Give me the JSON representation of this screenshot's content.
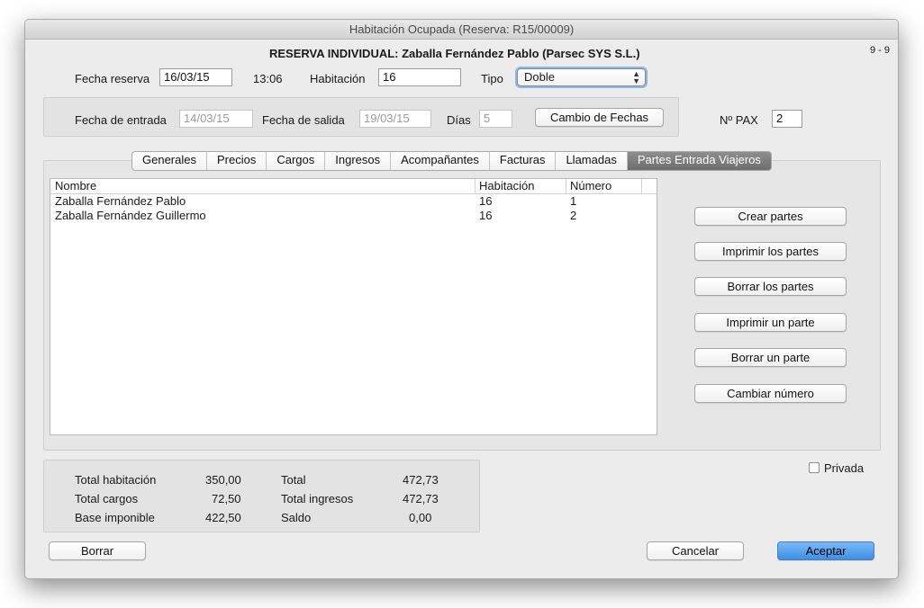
{
  "window": {
    "title": "Habitación Ocupada (Reserva: R15/00009)"
  },
  "header": {
    "title": "RESERVA INDIVIDUAL: Zaballa Fernández Pablo (Parsec SYS S.L.)",
    "record_counter": "9 - 9"
  },
  "reserva": {
    "fecha_label": "Fecha reserva",
    "fecha_value": "16/03/15",
    "hora": "13:06",
    "habitacion_label": "Habitación",
    "habitacion_value": "16",
    "tipo_label": "Tipo",
    "tipo_value": "Doble"
  },
  "fechas": {
    "entrada_label": "Fecha de entrada",
    "entrada_value": "14/03/15",
    "salida_label": "Fecha de salida",
    "salida_value": "19/03/15",
    "dias_label": "Días",
    "dias_value": "5",
    "cambio_button": "Cambio de Fechas"
  },
  "pax": {
    "label": "Nº PAX",
    "value": "2"
  },
  "tabs": [
    {
      "label": "Generales"
    },
    {
      "label": "Precios"
    },
    {
      "label": "Cargos"
    },
    {
      "label": "Ingresos"
    },
    {
      "label": "Acompañantes"
    },
    {
      "label": "Facturas"
    },
    {
      "label": "Llamadas"
    },
    {
      "label": "Partes Entrada Viajeros"
    }
  ],
  "table": {
    "columns": [
      "Nombre",
      "Habitación",
      "Número"
    ],
    "rows": [
      {
        "nombre": "Zaballa Fernández Pablo",
        "habitacion": "16",
        "numero": "1"
      },
      {
        "nombre": "Zaballa Fernández Guillermo",
        "habitacion": "16",
        "numero": "2"
      }
    ]
  },
  "actions": {
    "crear": "Crear partes",
    "imprimir_los": "Imprimir los partes",
    "borrar_los": "Borrar los partes",
    "imprimir_un": "Imprimir un parte",
    "borrar_un": "Borrar un parte",
    "cambiar_numero": "Cambiar número"
  },
  "totals": {
    "total_habitacion_label": "Total habitación",
    "total_habitacion_value": "350,00",
    "total_cargos_label": "Total cargos",
    "total_cargos_value": "72,50",
    "base_imponible_label": "Base imponible",
    "base_imponible_value": "422,50",
    "total_label": "Total",
    "total_value": "472,73",
    "total_ingresos_label": "Total ingresos",
    "total_ingresos_value": "472,73",
    "saldo_label": "Saldo",
    "saldo_value": "0,00"
  },
  "privada": {
    "label": "Privada",
    "checked": false
  },
  "footer": {
    "borrar": "Borrar",
    "cancelar": "Cancelar",
    "aceptar": "Aceptar"
  },
  "colors": {
    "accent": "#3d8ee8",
    "active_tab": "#7a7a7a"
  }
}
